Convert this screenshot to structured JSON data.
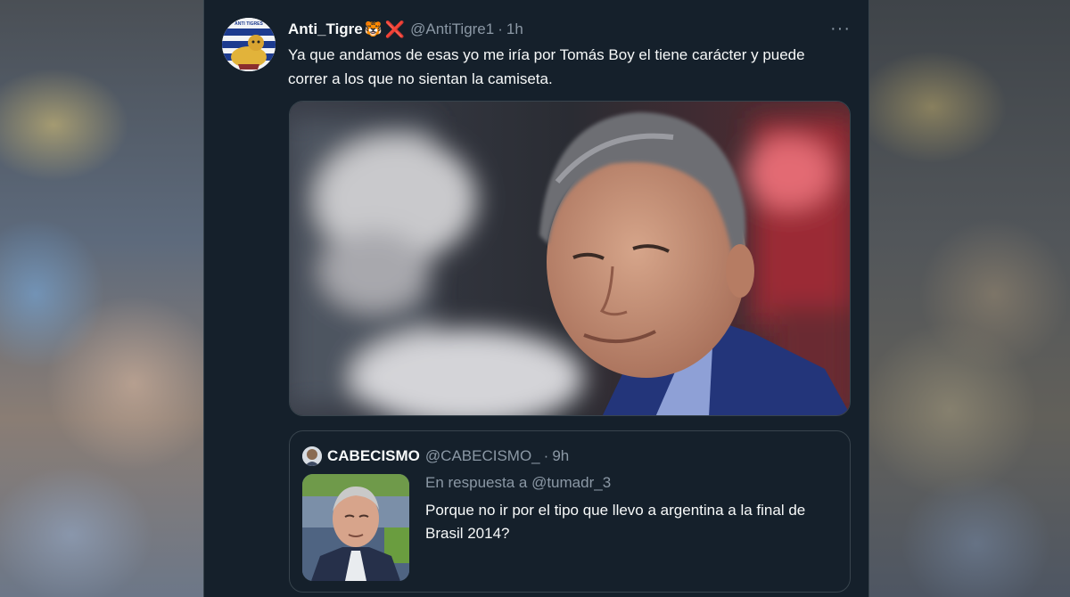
{
  "tweet": {
    "author_name": "Anti_Tigre",
    "author_emoji": "🐯",
    "author_mark": "❌",
    "handle": "@AntiTigre1",
    "separator": "·",
    "time": "1h",
    "more_label": "···",
    "text": "Ya que andamos de esas yo me iría por Tomás Boy el tiene carácter y puede correr a los que no sientan la camiseta.",
    "avatar_caption": "ANTI TIGRES"
  },
  "quoted": {
    "author_name": "CABECISMO",
    "handle": "@CABECISMO_",
    "separator": "·",
    "time": "9h",
    "reply_to": "En respuesta a @tumadr_3",
    "text": "Porque no ir por el tipo que llevo a argentina a la final de Brasil 2014?"
  },
  "colors": {
    "background": "#15202b",
    "border": "#38444d",
    "primary_text": "#f7f9f9",
    "secondary_text": "#8b98a5",
    "x_mark": "#e0245e"
  },
  "icons": {
    "more": "more-horizontal-icon",
    "avatar": "tiger-avatar-icon",
    "quoted_avatar": "cabecismo-avatar-icon"
  }
}
